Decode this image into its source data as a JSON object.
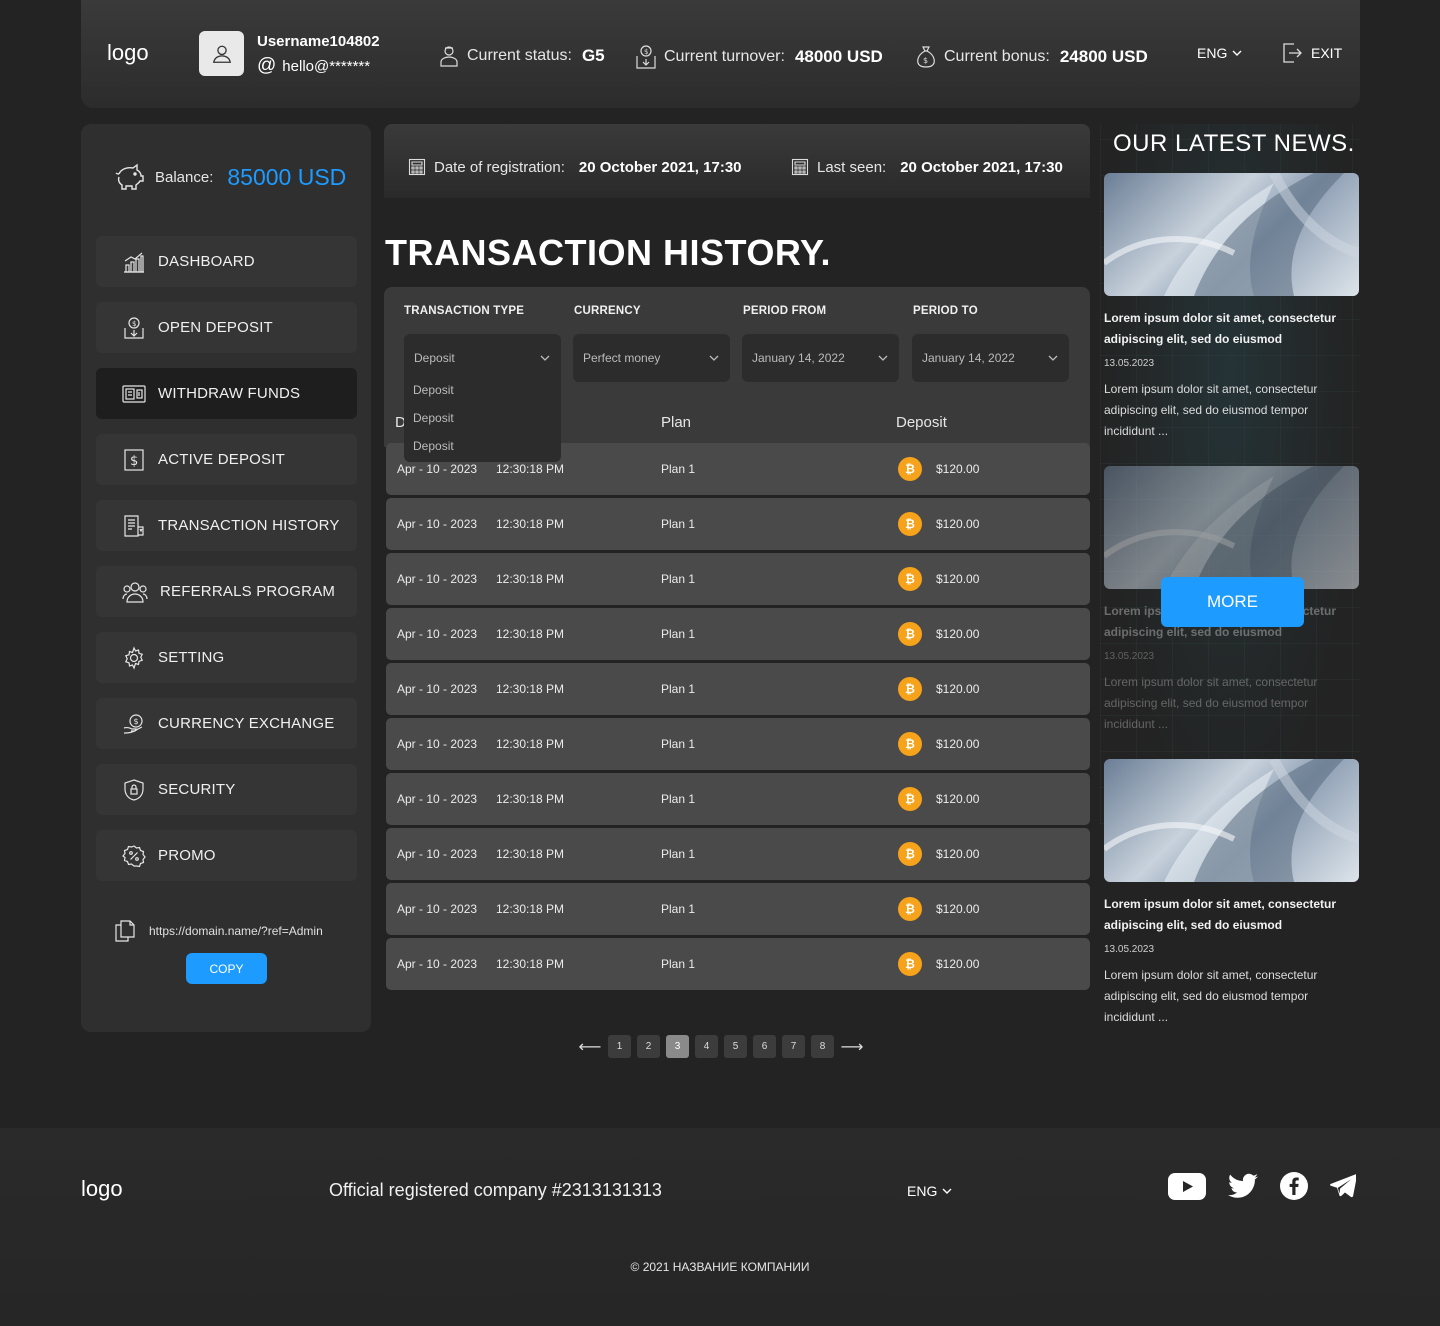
{
  "header": {
    "logo": "logo",
    "username": "Username104802",
    "email": "hello@*******",
    "status_label": "Current status:",
    "status_value": "G5",
    "turnover_label": "Current turnover:",
    "turnover_value": "48000 USD",
    "bonus_label": "Current bonus:",
    "bonus_value": "24800 USD",
    "language": "ENG",
    "exit_label": "EXIT"
  },
  "sidebar": {
    "balance_label": "Balance:",
    "balance_value": "85000 USD",
    "items": [
      {
        "label": "DASHBOARD",
        "icon": "chart-icon"
      },
      {
        "label": "OPEN DEPOSIT",
        "icon": "deposit-icon"
      },
      {
        "label": "WITHDRAW FUNDS",
        "icon": "wallet-icon",
        "active": true
      },
      {
        "label": "ACTIVE DEPOSIT",
        "icon": "dollar-icon"
      },
      {
        "label": "TRANSACTION HISTORY",
        "icon": "document-icon"
      },
      {
        "label": "REFERRALS PROGRAM",
        "icon": "users-icon"
      },
      {
        "label": "SETTING",
        "icon": "gear-icon"
      },
      {
        "label": "CURRENCY EXCHANGE",
        "icon": "exchange-icon"
      },
      {
        "label": "SECURITY",
        "icon": "shield-icon"
      },
      {
        "label": "PROMO",
        "icon": "percent-icon"
      }
    ],
    "ref_link": "https://domain.name/?ref=Admin",
    "copy_label": "COPY"
  },
  "info": {
    "registration_label": "Date of registration:",
    "registration_value": "20 October 2021, 17:30",
    "last_seen_label": "Last seen:",
    "last_seen_value": "20 October 2021, 17:30"
  },
  "page_title": "TRANSACTION HISTORY.",
  "filters": {
    "type_label": "TRANSACTION TYPE",
    "type_value": "Deposit",
    "type_options": [
      "Deposit",
      "Deposit",
      "Deposit"
    ],
    "currency_label": "CURRENCY",
    "currency_value": "Perfect money",
    "from_label": "PERIOD FROM",
    "from_value": "January 14, 2022",
    "to_label": "PERIOD TO",
    "to_value": "January 14, 2022"
  },
  "table": {
    "columns": [
      "D",
      "Plan",
      "Deposit"
    ],
    "rows": [
      {
        "date": "Apr - 10 - 2023",
        "time": "12:30:18 PM",
        "plan": "Plan 1",
        "amount": "$120.00"
      },
      {
        "date": "Apr - 10 - 2023",
        "time": "12:30:18 PM",
        "plan": "Plan 1",
        "amount": "$120.00"
      },
      {
        "date": "Apr - 10 - 2023",
        "time": "12:30:18 PM",
        "plan": "Plan 1",
        "amount": "$120.00"
      },
      {
        "date": "Apr - 10 - 2023",
        "time": "12:30:18 PM",
        "plan": "Plan 1",
        "amount": "$120.00"
      },
      {
        "date": "Apr - 10 - 2023",
        "time": "12:30:18 PM",
        "plan": "Plan 1",
        "amount": "$120.00"
      },
      {
        "date": "Apr - 10 - 2023",
        "time": "12:30:18 PM",
        "plan": "Plan 1",
        "amount": "$120.00"
      },
      {
        "date": "Apr - 10 - 2023",
        "time": "12:30:18 PM",
        "plan": "Plan 1",
        "amount": "$120.00"
      },
      {
        "date": "Apr - 10 - 2023",
        "time": "12:30:18 PM",
        "plan": "Plan 1",
        "amount": "$120.00"
      },
      {
        "date": "Apr - 10 - 2023",
        "time": "12:30:18 PM",
        "plan": "Plan 1",
        "amount": "$120.00"
      },
      {
        "date": "Apr - 10 - 2023",
        "time": "12:30:18 PM",
        "plan": "Plan 1",
        "amount": "$120.00"
      }
    ]
  },
  "pagination": {
    "pages": [
      "1",
      "2",
      "3",
      "4",
      "5",
      "6",
      "7",
      "8"
    ],
    "current": "3",
    "prev": "⟵",
    "next": "⟶"
  },
  "news": {
    "title": "OUR LATEST NEWS.",
    "more_label": "MORE",
    "items": [
      {
        "headline": "Lorem ipsum dolor sit amet, consectetur adipiscing elit, sed do eiusmod",
        "date": "13.05.2023",
        "text": "Lorem ipsum dolor sit amet, consectetur adipiscing elit, sed do eiusmod tempor incididunt ..."
      },
      {
        "headline": "Lorem ipsum dolor sit amet, consectetur adipiscing elit, sed do eiusmod",
        "date": "13.05.2023",
        "text": "Lorem ipsum dolor sit amet, consectetur adipiscing elit, sed do eiusmod tempor incididunt ..."
      },
      {
        "headline": "Lorem ipsum dolor sit amet, consectetur adipiscing elit, sed do eiusmod",
        "date": "13.05.2023",
        "text": "Lorem ipsum dolor sit amet, consectetur adipiscing elit, sed do eiusmod tempor incididunt ..."
      }
    ]
  },
  "footer": {
    "logo": "logo",
    "company": "Official registered company #2313131313",
    "language": "ENG",
    "copyright": "© 2021 НАЗВАНИЕ КОМПАНИИ",
    "socials": [
      "youtube-icon",
      "twitter-icon",
      "facebook-icon",
      "telegram-icon"
    ]
  },
  "colors": {
    "accent": "#1e9bff",
    "background": "#232323",
    "bitcoin": "#f7a21b"
  }
}
